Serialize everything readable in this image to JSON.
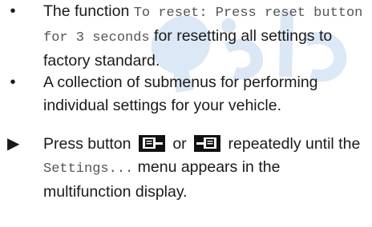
{
  "watermark_text": "دانلود",
  "items": [
    {
      "marker": "•",
      "text_before": "The function ",
      "code": "To reset: Press reset button for 3 seconds",
      "text_after": " for resetting all settings to factory standard."
    },
    {
      "marker": "•",
      "text": "A collection of submenus for performing individual settings for your vehicle."
    },
    {
      "marker": "▶",
      "text_before": "Press button ",
      "icon1": "left-page-button-icon",
      "text_mid": " or ",
      "icon2": "right-page-button-icon",
      "text_mid2": " repeatedly until the ",
      "code": "Settings...",
      "text_after": " menu appears in the multifunction display."
    }
  ]
}
